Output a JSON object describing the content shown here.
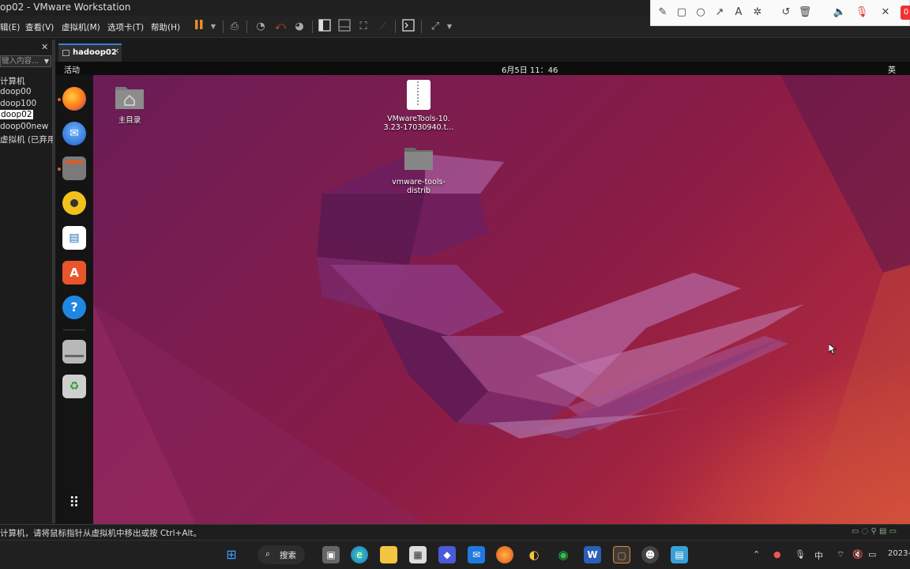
{
  "window": {
    "title": "op02 - VMware Workstation"
  },
  "menu": {
    "items": [
      "辑(E)",
      "查看(V)",
      "虚拟机(M)",
      "选项卡(T)",
      "帮助(H)"
    ]
  },
  "library": {
    "close": "✕",
    "search_placeholder": "键入内容...",
    "items": [
      "计算机",
      "doop00",
      "doop100",
      "doop02",
      "doop00new",
      "虚拟机 (已弃用)"
    ],
    "selected_index": 3
  },
  "tab": {
    "label": "hadoop02",
    "close": "✕"
  },
  "ubuntu": {
    "activities": "活动",
    "clock": "6月5日  11：46",
    "input_method": "英"
  },
  "desktop": {
    "home_label": "主目录",
    "file1_label_line1": "VMwareTools-10.",
    "file1_label_line2": "3.23-17030940.t...",
    "folder_label_line1": "vmware-tools-",
    "folder_label_line2": "distrib"
  },
  "dock": {
    "apps": [
      "firefox-icon",
      "thunderbird-icon",
      "files-icon",
      "rhythmbox-icon",
      "libreoffice-writer-icon",
      "app-center-icon",
      "help-icon",
      "drive-icon",
      "trash-icon",
      "show-apps-icon"
    ]
  },
  "statusbar": {
    "message": "计算机，请将鼠标指针从虚拟机中移出或按 Ctrl+Alt。"
  },
  "taskbar": {
    "search_label": "搜索",
    "ime": "中",
    "date_partial": "2023-"
  },
  "annotation_toolbar": {
    "record_badge": "0"
  },
  "colors": {
    "desktop_accent": "#8a1c45",
    "tab_underline": "#3b7dd8",
    "vm_pause": "#e88a2a"
  }
}
